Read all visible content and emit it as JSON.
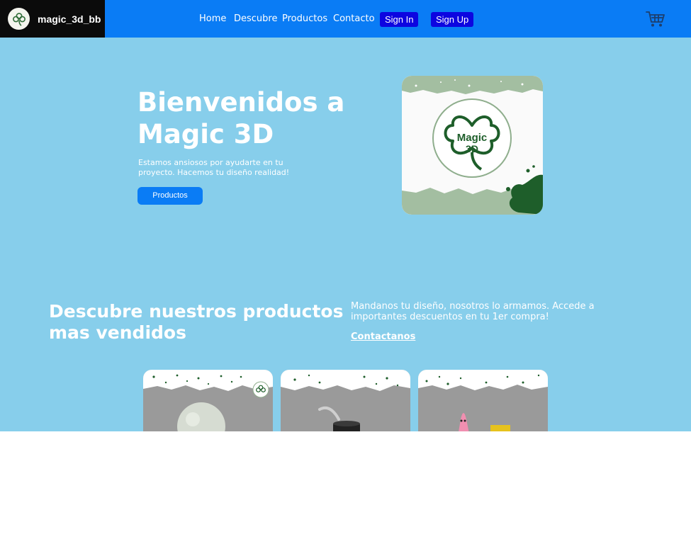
{
  "brand": {
    "name": "magic_3d_bb",
    "logo_icon": "shamrock-logo-icon"
  },
  "nav": {
    "links": [
      "Home",
      "Descubre",
      "Productos",
      "Contacto"
    ],
    "sign_in": "Sign In",
    "sign_up": "Sign Up",
    "cart_icon": "shopping-cart-icon"
  },
  "hero": {
    "title": "Bienvenidos a Magic 3D",
    "subtitle": "Estamos ansiosos por ayudarte en tu proyecto. Hacemos tu diseño realidad!",
    "button": "Productos",
    "logo_text_line1": "Magic",
    "logo_text_line2": "3D"
  },
  "featured": {
    "title": "Descubre nuestros productos mas vendidos",
    "text": "Mandanos tu diseño, nosotros lo armamos. Accede a importantes descuentos en tu 1er compra!",
    "link": "Contactanos"
  },
  "colors": {
    "nav_blue": "#0a7cf5",
    "button_blue": "#0d05e0",
    "sky_blue": "#87ceeb",
    "brand_green": "#1e5e2a"
  }
}
